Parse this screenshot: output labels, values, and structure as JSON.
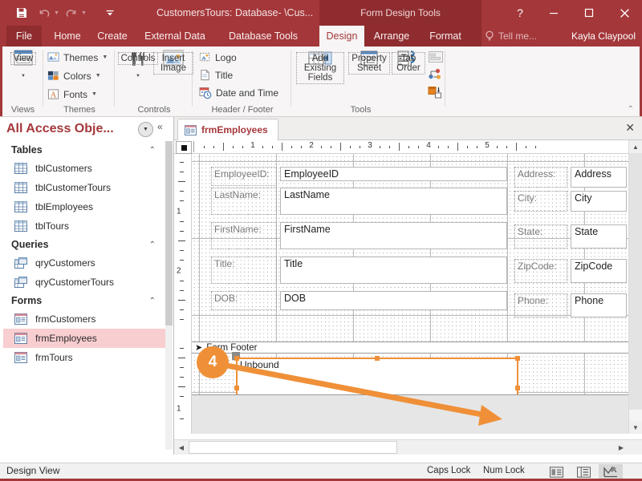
{
  "titlebar": {
    "quick_access": [
      {
        "name": "save-icon",
        "label": "Save"
      },
      {
        "name": "undo-icon",
        "label": "Undo"
      },
      {
        "name": "redo-icon",
        "label": "Redo"
      },
      {
        "name": "customize-quick-access-icon",
        "label": "Customize Quick Access Toolbar"
      }
    ],
    "document_title": "CustomersTours: Database- \\Cus...",
    "contextual_tools": "Form Design Tools",
    "help": "?",
    "minimize": "—",
    "restore": "☐",
    "close": "✕"
  },
  "ribbon_tabs": {
    "file": "File",
    "tabs": [
      "Home",
      "Create",
      "External Data",
      "Database Tools"
    ],
    "contextual": [
      "Design",
      "Arrange",
      "Format"
    ],
    "active": "Design",
    "tell_me": "Tell me...",
    "account": "Kayla Claypool"
  },
  "ribbon": {
    "groups": [
      {
        "name": "Views",
        "label": "Views",
        "buttons": [
          {
            "label": "View",
            "icon": "view-icon",
            "has_dropdown": true
          }
        ]
      },
      {
        "name": "Themes",
        "label": "Themes",
        "items": [
          {
            "label": "Themes",
            "icon": "themes-icon",
            "has_dropdown": true
          },
          {
            "label": "Colors",
            "icon": "colors-icon",
            "has_dropdown": true
          },
          {
            "label": "Fonts",
            "icon": "fonts-icon",
            "has_dropdown": true
          }
        ]
      },
      {
        "name": "Controls",
        "label": "Controls",
        "buttons": [
          {
            "label": "Controls",
            "icon": "controls-icon",
            "has_dropdown": true
          },
          {
            "label": "Insert Image",
            "icon": "insert-image-icon",
            "has_dropdown": true
          }
        ]
      },
      {
        "name": "HeaderFooter",
        "label": "Header / Footer",
        "items": [
          {
            "label": "Logo",
            "icon": "logo-icon"
          },
          {
            "label": "Title",
            "icon": "title-icon"
          },
          {
            "label": "Date and Time",
            "icon": "date-and-time-icon"
          }
        ]
      },
      {
        "name": "Tools",
        "label": "Tools",
        "buttons": [
          {
            "label": "Add Existing Fields",
            "icon": "add-existing-fields-icon"
          },
          {
            "label": "Property Sheet",
            "icon": "property-sheet-icon"
          },
          {
            "label": "Tab Order",
            "icon": "tab-order-icon"
          }
        ],
        "small_icons": [
          {
            "name": "subform-in-new-window-icon"
          },
          {
            "name": "convert-macros-icon"
          },
          {
            "name": "convert-form-to-report-icon"
          }
        ]
      }
    ],
    "collapse_ribbon": "⌃"
  },
  "nav_pane": {
    "title": "All Access Obje...",
    "dropdown_icon": "chevron-down-icon",
    "collapse_icon": "double-chevron-left-icon",
    "groups": [
      {
        "label": "Tables",
        "items": [
          {
            "label": "tblCustomers",
            "icon": "table-icon"
          },
          {
            "label": "tblCustomerTours",
            "icon": "table-icon"
          },
          {
            "label": "tblEmployees",
            "icon": "table-icon"
          },
          {
            "label": "tblTours",
            "icon": "table-icon"
          }
        ]
      },
      {
        "label": "Queries",
        "items": [
          {
            "label": "qryCustomers",
            "icon": "query-icon"
          },
          {
            "label": "qryCustomerTours",
            "icon": "query-icon"
          }
        ]
      },
      {
        "label": "Forms",
        "items": [
          {
            "label": "frmCustomers",
            "icon": "form-icon",
            "selected": false
          },
          {
            "label": "frmEmployees",
            "icon": "form-icon",
            "selected": true
          },
          {
            "label": "frmTours",
            "icon": "form-icon",
            "selected": false
          }
        ]
      }
    ]
  },
  "document": {
    "tab_label": "frmEmployees",
    "tab_icon": "form-icon",
    "close_icon": "✕",
    "ruler": {
      "horizontal_numbers": [
        "1",
        "2",
        "3",
        "4",
        "5"
      ],
      "vertical_numbers": [
        "1",
        "2",
        "1"
      ]
    },
    "detail_section": {
      "left_column": [
        {
          "label": "EmployeeID:",
          "control": "EmployeeID"
        },
        {
          "label": "LastName:",
          "control": "LastName"
        },
        {
          "label": "FirstName:",
          "control": "FirstName"
        },
        {
          "label": "Title:",
          "control": "Title"
        },
        {
          "label": "DOB:",
          "control": "DOB"
        }
      ],
      "right_column": [
        {
          "label": "Address:",
          "control": "Address"
        },
        {
          "label": "City:",
          "control": "City"
        },
        {
          "label": "State:",
          "control": "State"
        },
        {
          "label": "ZipCode:",
          "control": "ZipCode"
        },
        {
          "label": "Phone:",
          "control": "Phone"
        }
      ]
    },
    "footer_band": {
      "label": "Form Footer",
      "band_icon": "band-arrow-icon",
      "selected_control_text": "Unbound"
    }
  },
  "callout": {
    "number": "4",
    "color": "#ef9038"
  },
  "status_bar": {
    "mode": "Design View",
    "caps_lock": "Caps Lock",
    "num_lock": "Num Lock",
    "view_buttons": [
      {
        "name": "form-view-button",
        "icon": "form-view-icon",
        "active": false
      },
      {
        "name": "layout-view-button",
        "icon": "layout-view-icon",
        "active": false
      },
      {
        "name": "design-view-button",
        "icon": "design-view-icon",
        "active": true
      }
    ]
  },
  "colors": {
    "accent": "#a4373a",
    "contextual": "#8e2c2f",
    "callout": "#ef9038",
    "selection": "#f9ced1"
  }
}
